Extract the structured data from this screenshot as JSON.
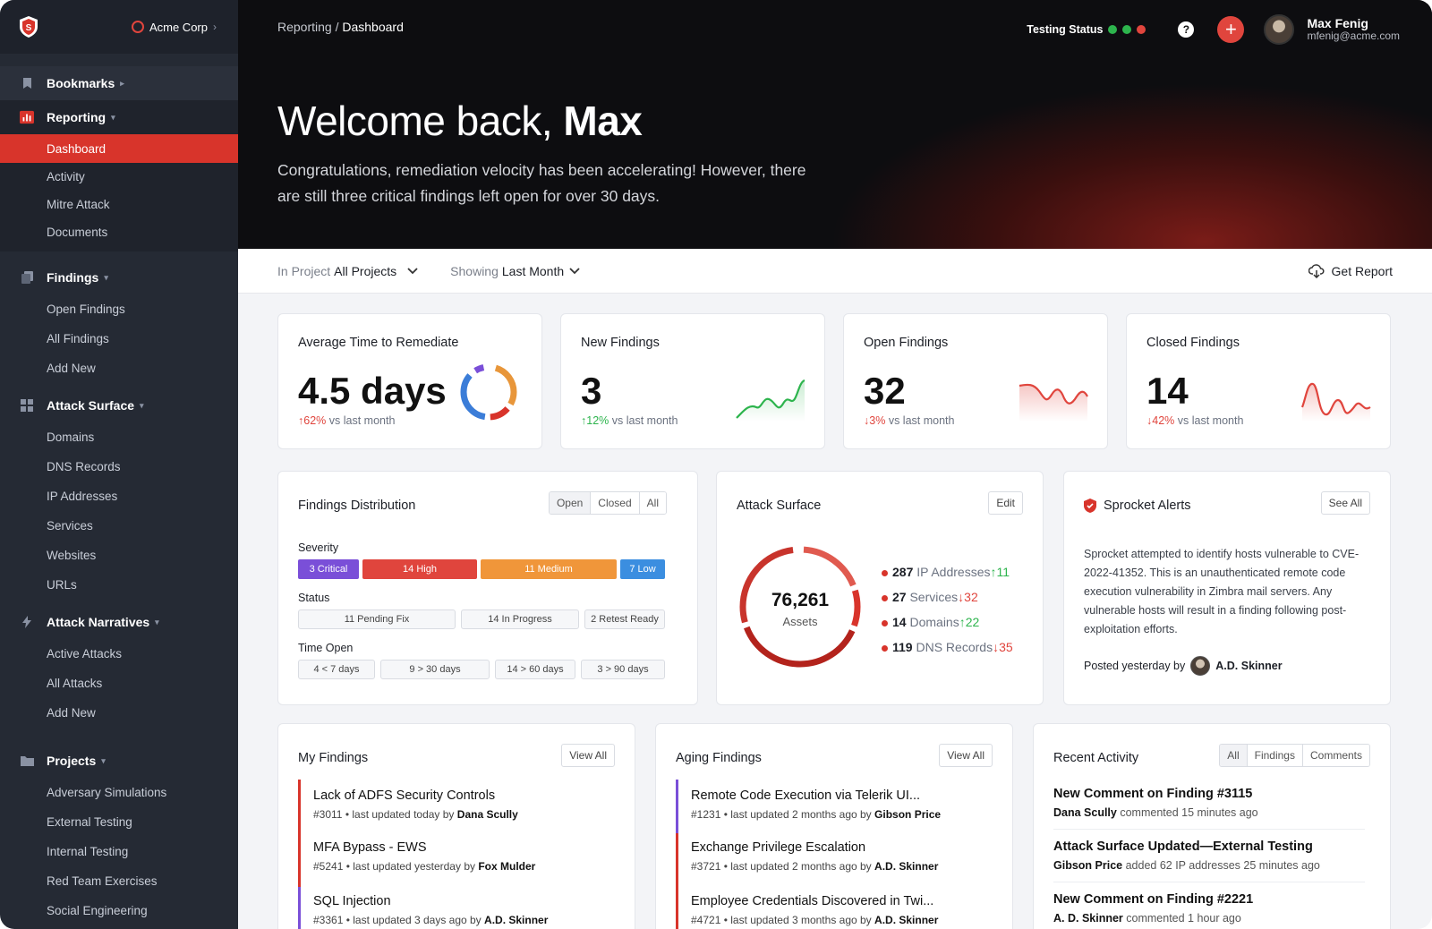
{
  "org": {
    "name": "Acme Corp"
  },
  "sidebar": {
    "bookmarks": "Bookmarks",
    "reporting": {
      "label": "Reporting",
      "items": [
        "Dashboard",
        "Activity",
        "Mitre Attack",
        "Documents"
      ]
    },
    "findings": {
      "label": "Findings",
      "items": [
        "Open Findings",
        "All Findings",
        "Add New"
      ]
    },
    "attack_surface": {
      "label": "Attack Surface",
      "items": [
        "Domains",
        "DNS Records",
        "IP Addresses",
        "Services",
        "Websites",
        "URLs"
      ]
    },
    "attack_narratives": {
      "label": "Attack Narratives",
      "items": [
        "Active Attacks",
        "All Attacks",
        "Add New"
      ]
    },
    "projects": {
      "label": "Projects",
      "items": [
        "Adversary Simulations",
        "External Testing",
        "Internal Testing",
        "Red Team Exercises",
        "Social  Engineering"
      ]
    }
  },
  "header": {
    "breadcrumb_parent": "Reporting",
    "breadcrumb_sep": " / ",
    "breadcrumb_current": "Dashboard",
    "testing_status": "Testing Status",
    "status_colors": [
      "#2db44d",
      "#2db44d",
      "#e0453d"
    ],
    "user_name": "Max Fenig",
    "user_email": "mfenig@acme.com",
    "help": "?",
    "plus": "+"
  },
  "hero": {
    "welcome_prefix": "Welcome back, ",
    "welcome_name": "Max",
    "message": "Congratulations, remediation velocity has been accelerating! However, there are still three critical findings left open for over 30 days."
  },
  "filters": {
    "project_label": "In Project",
    "project_value": "All Projects",
    "showing_label": "Showing",
    "showing_value": "Last Month",
    "get_report": "Get Report"
  },
  "stats": [
    {
      "title": "Average Time to Remediate",
      "value": "4.5 days",
      "delta": "62%",
      "delta_text": "vs last month"
    },
    {
      "title": "New Findings",
      "value": "3",
      "delta": "12%",
      "delta_text": "vs last month"
    },
    {
      "title": "Open Findings",
      "value": "32",
      "delta": "3%",
      "delta_text": "vs last month"
    },
    {
      "title": "Closed Findings",
      "value": "14",
      "delta": "42%",
      "delta_text": "vs last month"
    }
  ],
  "distribution": {
    "title": "Findings Distribution",
    "tabs": [
      "Open",
      "Closed",
      "All"
    ],
    "severity_label": "Severity",
    "severity": [
      "3 Critical",
      "14 High",
      "11 Medium",
      "7 Low"
    ],
    "status_label": "Status",
    "status": [
      "11 Pending Fix",
      "14 In Progress",
      "2 Retest Ready"
    ],
    "time_label": "Time Open",
    "time": [
      "4 < 7 days",
      "9 > 30 days",
      "14 > 60 days",
      "3 > 90 days"
    ]
  },
  "attack_surface": {
    "title": "Attack Surface",
    "edit": "Edit",
    "total": "76,261",
    "total_label": "Assets",
    "rows": [
      {
        "count": "287",
        "name": "IP Addresses",
        "delta": "↑11",
        "dir": "up"
      },
      {
        "count": "27",
        "name": "Services",
        "delta": "↓32",
        "dir": "down"
      },
      {
        "count": "14",
        "name": "Domains",
        "delta": "↑22",
        "dir": "up"
      },
      {
        "count": "119",
        "name": "DNS Records",
        "delta": "↓35",
        "dir": "down"
      }
    ]
  },
  "alerts": {
    "title": "Sprocket Alerts",
    "see_all": "See All",
    "body": "Sprocket attempted to identify hosts vulnerable to CVE-2022-41352. This is an unauthenticated remote code execution vulnerability in Zimbra mail servers. Any vulnerable hosts will result in a finding following post-exploitation efforts.",
    "posted_prefix": "Posted yesterday by",
    "author": "A.D. Skinner"
  },
  "my_findings": {
    "title": "My Findings",
    "view_all": "View All",
    "items": [
      {
        "title": "Lack of ADFS Security Controls",
        "meta": "#3011 • last updated today by",
        "by": "Dana Scully"
      },
      {
        "title": "MFA Bypass - EWS",
        "meta": "#5241 • last updated yesterday by",
        "by": "Fox Mulder"
      },
      {
        "title": "SQL Injection",
        "meta": "#3361 • last updated 3 days ago by",
        "by": "A.D. Skinner"
      }
    ]
  },
  "aging_findings": {
    "title": "Aging Findings",
    "view_all": "View All",
    "items": [
      {
        "title": "Remote Code Execution via Telerik UI...",
        "meta": "#1231 • last updated 2 months ago by",
        "by": "Gibson Price"
      },
      {
        "title": "Exchange Privilege Escalation",
        "meta": "#3721 • last updated 2 months ago by",
        "by": "A.D. Skinner"
      },
      {
        "title": "Employee Credentials Discovered in Twi...",
        "meta": "#4721 • last updated 3 months ago by",
        "by": "A.D. Skinner"
      }
    ]
  },
  "recent_activity": {
    "title": "Recent Activity",
    "tabs": [
      "All",
      "Findings",
      "Comments"
    ],
    "items": [
      {
        "title": "New Comment on Finding #3115",
        "who": "Dana Scully",
        "what": "commented 15 minutes ago"
      },
      {
        "title": "Attack Surface Updated—External Testing",
        "who": "Gibson Price",
        "what": "added 62 IP addresses 25 minutes ago"
      },
      {
        "title": "New Comment on Finding #2221",
        "who": "A. D. Skinner",
        "what": "commented 1 hour ago"
      }
    ]
  }
}
